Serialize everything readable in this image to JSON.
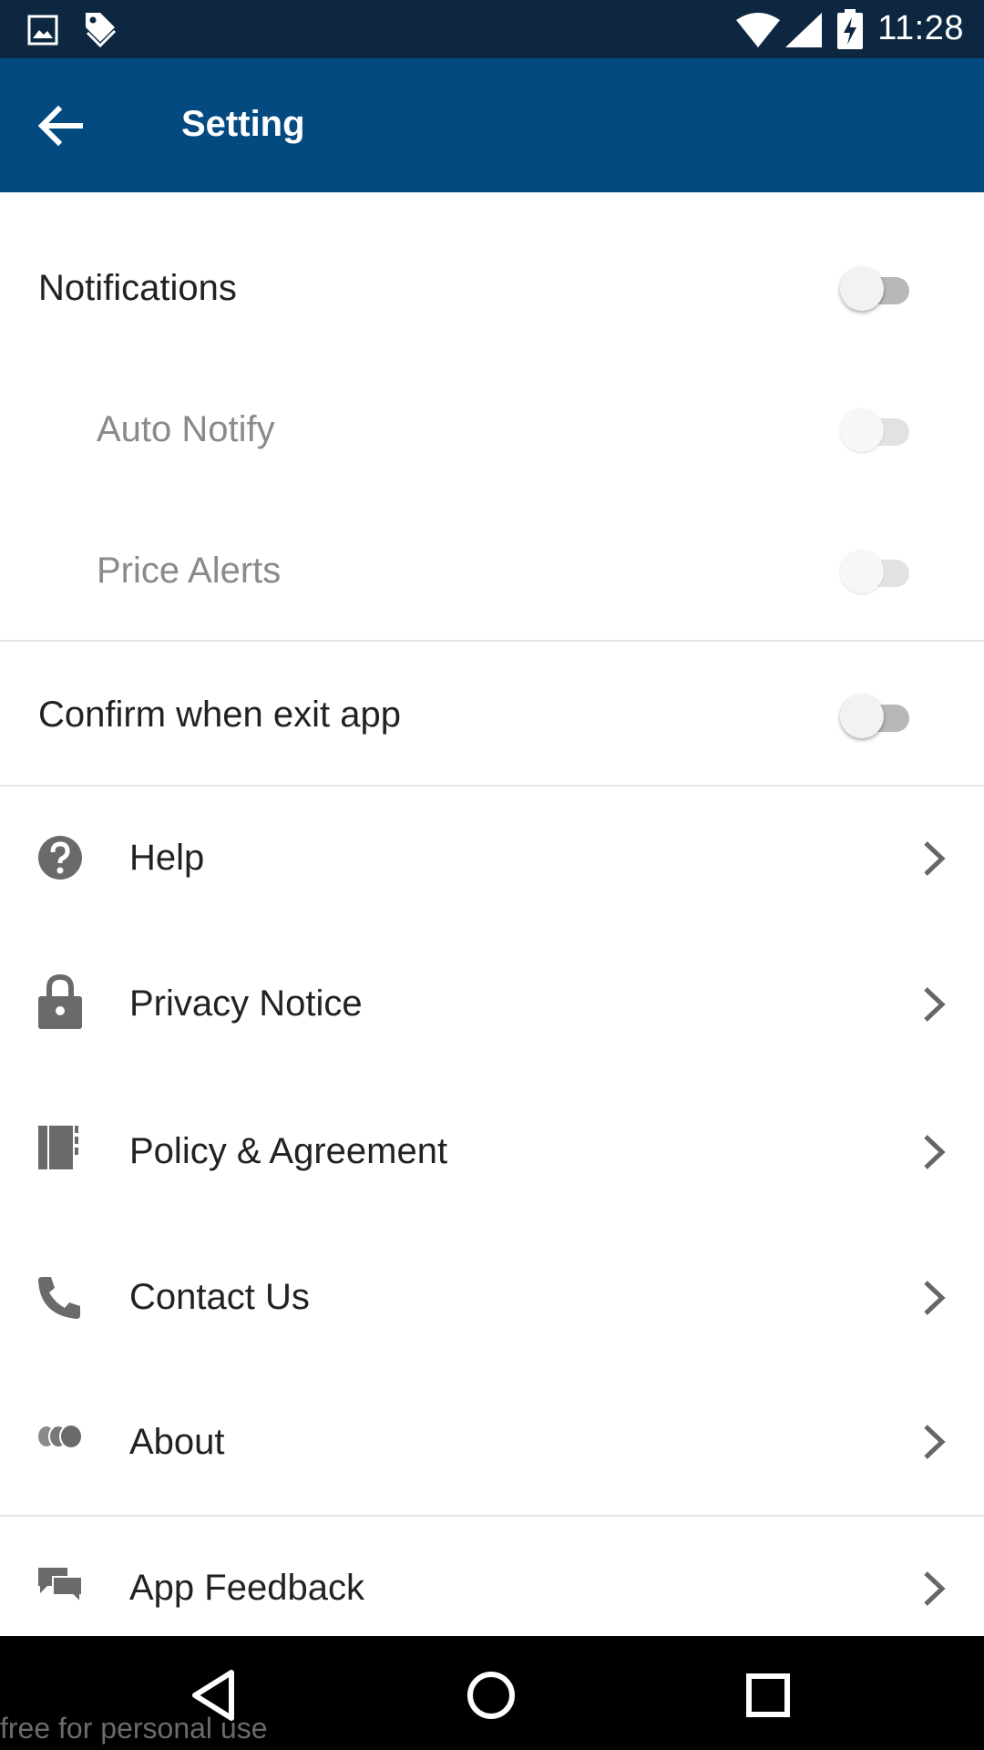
{
  "status_bar": {
    "time": "11:28",
    "icons": [
      "image-icon",
      "tag-icon",
      "wifi-icon",
      "signal-icon",
      "battery-charging-icon"
    ]
  },
  "app_bar": {
    "title": "Setting",
    "back_icon": "arrow-left-icon",
    "background_color": "#024a80"
  },
  "toggles": {
    "notifications": {
      "label": "Notifications",
      "on": false,
      "enabled": true
    },
    "auto_notify": {
      "label": "Auto Notify",
      "on": false,
      "enabled": false
    },
    "price_alerts": {
      "label": "Price Alerts",
      "on": false,
      "enabled": false
    },
    "confirm_exit": {
      "label": "Confirm when exit app",
      "on": false,
      "enabled": true
    }
  },
  "menu": {
    "items": [
      {
        "label": "Help",
        "icon": "help-circle-icon"
      },
      {
        "label": "Privacy Notice",
        "icon": "lock-icon"
      },
      {
        "label": "Policy & Agreement",
        "icon": "book-icon"
      },
      {
        "label": "Contact Us",
        "icon": "phone-icon"
      },
      {
        "label": "About",
        "icon": "circles-icon"
      },
      {
        "label": "App Feedback",
        "icon": "feedback-icon"
      }
    ]
  },
  "nav_bar": {
    "buttons": [
      "back-triangle-icon",
      "home-circle-icon",
      "recents-square-icon"
    ]
  },
  "watermark": "free for personal use"
}
